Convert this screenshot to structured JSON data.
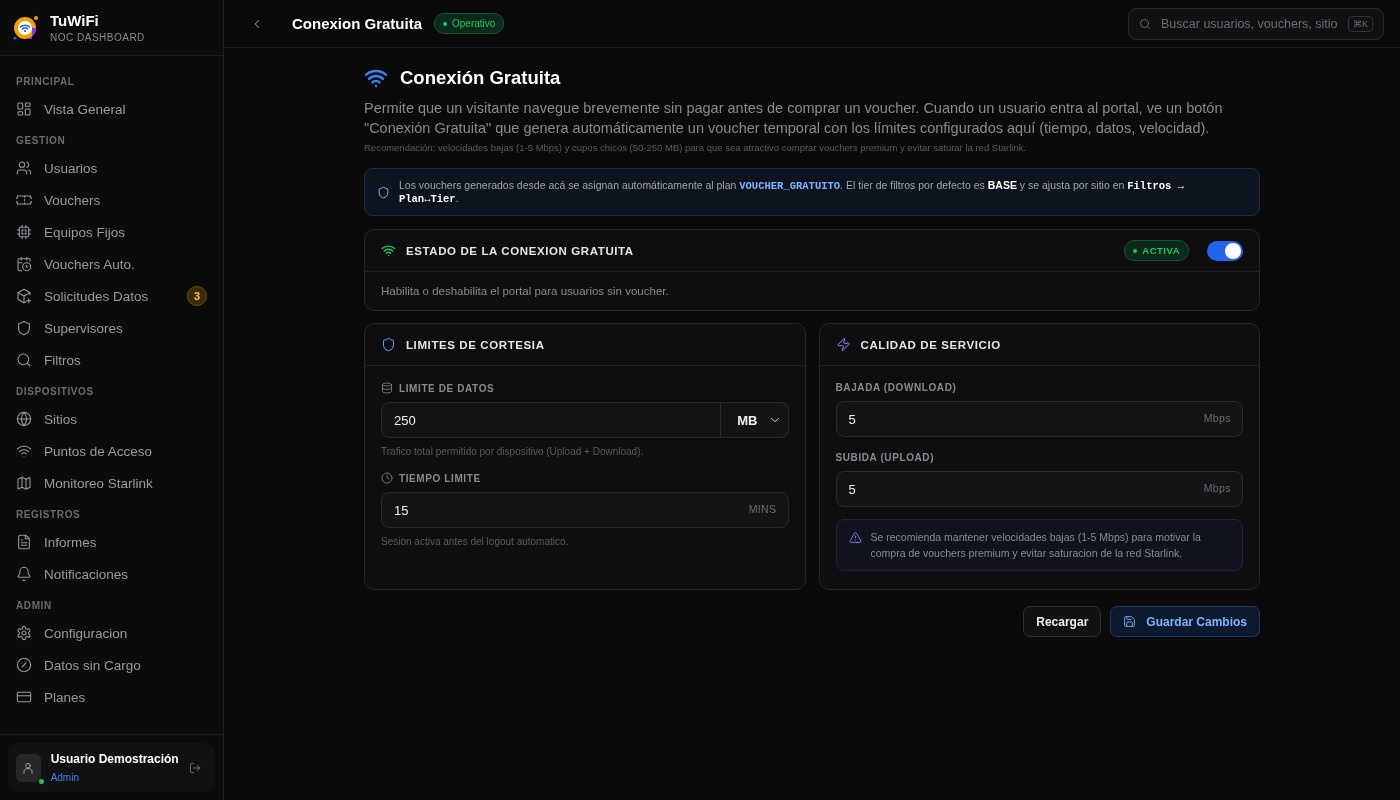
{
  "brand": {
    "name": "TuWiFi",
    "subtitle": "NOC DASHBOARD"
  },
  "sidebar": {
    "sections": [
      {
        "title": "PRINCIPAL",
        "items": [
          {
            "label": "Vista General",
            "selected": false
          }
        ]
      },
      {
        "title": "GESTION",
        "items": [
          {
            "label": "Usuarios",
            "selected": false
          },
          {
            "label": "Vouchers",
            "selected": false
          },
          {
            "label": "Equipos Fijos",
            "selected": false
          },
          {
            "label": "Vouchers Auto.",
            "selected": false
          },
          {
            "label": "Solicitudes Datos",
            "selected": false,
            "badge": "3"
          },
          {
            "label": "Supervisores",
            "selected": false
          },
          {
            "label": "Filtros",
            "selected": false
          }
        ]
      },
      {
        "title": "DISPOSITIVOS",
        "items": [
          {
            "label": "Sitios",
            "selected": false
          },
          {
            "label": "Puntos de Acceso",
            "selected": false
          },
          {
            "label": "Monitoreo Starlink",
            "selected": false
          }
        ]
      },
      {
        "title": "REGISTROS",
        "items": [
          {
            "label": "Informes",
            "selected": false
          },
          {
            "label": "Notificaciones",
            "selected": false
          }
        ]
      },
      {
        "title": "ADMIN",
        "items": [
          {
            "label": "Configuracion",
            "selected": false
          },
          {
            "label": "Datos sin Cargo",
            "selected": false
          },
          {
            "label": "Planes",
            "selected": false
          }
        ]
      }
    ]
  },
  "user": {
    "name": "Usuario Demostración",
    "role": "Admin",
    "online": true
  },
  "topbar": {
    "title": "Conexion Gratuita",
    "status": "Operativo",
    "search": {
      "placeholder": "Buscar usuarios, vouchers, sitio",
      "shortcut": "⌘K"
    }
  },
  "page": {
    "title": "Conexión Gratuita",
    "description": "Permite que un visitante navegue brevemente sin pagar antes de comprar un voucher. Cuando un usuario entra al portal, ve un botón \"Conexión Gratuita\" que genera automáticamente un voucher temporal con los límites configurados aquí (tiempo, datos, velocidad).",
    "recommendation": "Recomendación: velocidades bajas (1-5 Mbps) y cupos chicos (50-250 MB) para que sea atractivo comprar vouchers premium y evitar saturar la red Starlink.",
    "info": "Los vouchers generados desde acá se asignan automáticamente al plan *VOUCHER_GRATUITO*. El tier de filtros por defecto es **BASE** y se ajusta por sitio en **Filtros → Plan↔Tier**."
  },
  "status_card": {
    "title": "ESTADO DE LA CONEXION GRATUITA",
    "status": "ACTIVA",
    "on": true,
    "description": "Habilita o deshabilita el portal para usuarios sin voucher."
  },
  "limits_card": {
    "title": "LIMITES DE CORTESIA",
    "fields": [
      {
        "label": "LIMITE DE DATOS",
        "value": "250",
        "kind": "select",
        "unit": "MB",
        "hint": "Trafico total permitido por dispositivo (Upload + Download)."
      },
      {
        "label": "TIEMPO LIMITE",
        "value": "15",
        "kind": "suffix",
        "unit": "MINS",
        "hint": "Sesion activa antes del logout automatico."
      }
    ]
  },
  "qos_card": {
    "title": "CALIDAD DE SERVICIO",
    "fields": [
      {
        "label": "BAJADA (DOWNLOAD)",
        "value": "5",
        "kind": "suffix",
        "unit": "Mbps"
      },
      {
        "label": "SUBIDA (UPLOAD)",
        "value": "5",
        "kind": "suffix",
        "unit": "Mbps"
      }
    ],
    "warning": "Se recomienda mantener velocidades bajas (1-5 Mbps) para motivar la compra de vouchers premium y evitar saturacion de la red Starlink."
  },
  "buttons": [
    {
      "label": "Recargar",
      "kind": "secondary"
    },
    {
      "label": "Guardar Cambios",
      "kind": "primary"
    }
  ]
}
